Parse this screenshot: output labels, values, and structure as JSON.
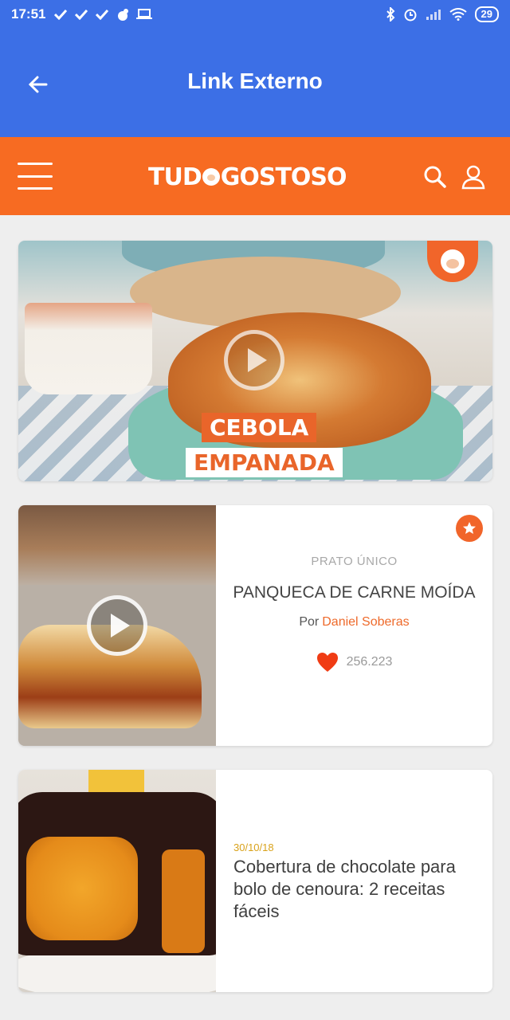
{
  "status_bar": {
    "time": "17:51",
    "battery": "29"
  },
  "app_bar": {
    "title": "Link Externo"
  },
  "site_header": {
    "logo_text_left": "TUD",
    "logo_text_right": "GOSTOSO"
  },
  "hero": {
    "label_line1": "CEBOLA",
    "label_line2": "EMPANADA"
  },
  "recipe_card": {
    "category": "PRATO ÚNICO",
    "title": "PANQUECA DE CARNE MOÍDA",
    "by_prefix": "Por",
    "author": "Daniel Soberas",
    "likes": "256.223"
  },
  "post_card": {
    "date": "30/10/18",
    "title": "Cobertura de chocolate para bolo de cenoura: 2 receitas fáceis"
  },
  "colors": {
    "app_bar": "#3c6fe6",
    "brand_orange": "#f76b22",
    "date_accent": "#d9a21b"
  }
}
